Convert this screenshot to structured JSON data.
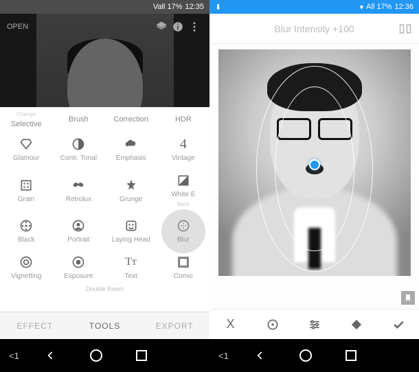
{
  "left": {
    "status": {
      "volume": "Vall 17%",
      "time": "12:35"
    },
    "top": {
      "open_label": "OPEN"
    },
    "rows": [
      [
        {
          "label": "Selective",
          "sub": "Change"
        },
        {
          "label": "Brush"
        },
        {
          "label": "Correction"
        },
        {
          "label": "HDR"
        }
      ],
      [
        {
          "icon": "diamond-icon",
          "label": "Glamour"
        },
        {
          "icon": "contrast-icon",
          "label": "Contr. Tonal"
        },
        {
          "icon": "cloud-icon",
          "label": "Emphasis"
        },
        {
          "icon": "four-icon",
          "label": "Vintage"
        }
      ],
      [
        {
          "icon": "grain-icon",
          "label": "Grain"
        },
        {
          "icon": "mustache-icon",
          "label": "Retrolux"
        },
        {
          "icon": "grunge-icon",
          "label": "Grunge"
        },
        {
          "icon": "whitee-icon",
          "label": "White E",
          "sub": "Back"
        }
      ],
      [
        {
          "icon": "film-icon",
          "label": "Black"
        },
        {
          "icon": "portrait-icon",
          "label": "Portrait"
        },
        {
          "icon": "face-icon",
          "label": "Laying Head"
        },
        {
          "icon": "blur-icon",
          "label": "Blur",
          "highlight": true
        }
      ],
      [
        {
          "icon": "vignette-icon",
          "label": "Vignetting"
        },
        {
          "icon": "exposure-icon",
          "label": "Exposure"
        },
        {
          "icon": "text-icon",
          "label": "Text"
        },
        {
          "icon": "frame-icon",
          "label": "Comic"
        }
      ]
    ],
    "subrow": {
      "label": "Double Room"
    },
    "tabs": {
      "effect": "EFFECT",
      "tools": "TOOLS",
      "export": "EXPORT"
    },
    "nav": {
      "lt": "<1"
    }
  },
  "right": {
    "status": {
      "signal": "All 17%",
      "time": "12:36"
    },
    "header": {
      "title": "Blur Intensity +100"
    },
    "toolbar": {
      "cancel": "X",
      "focus": "focus-icon",
      "adjust": "sliders-icon",
      "shape": "diamond-icon",
      "apply": "check-icon"
    },
    "nav": {
      "lt": "<1"
    }
  }
}
